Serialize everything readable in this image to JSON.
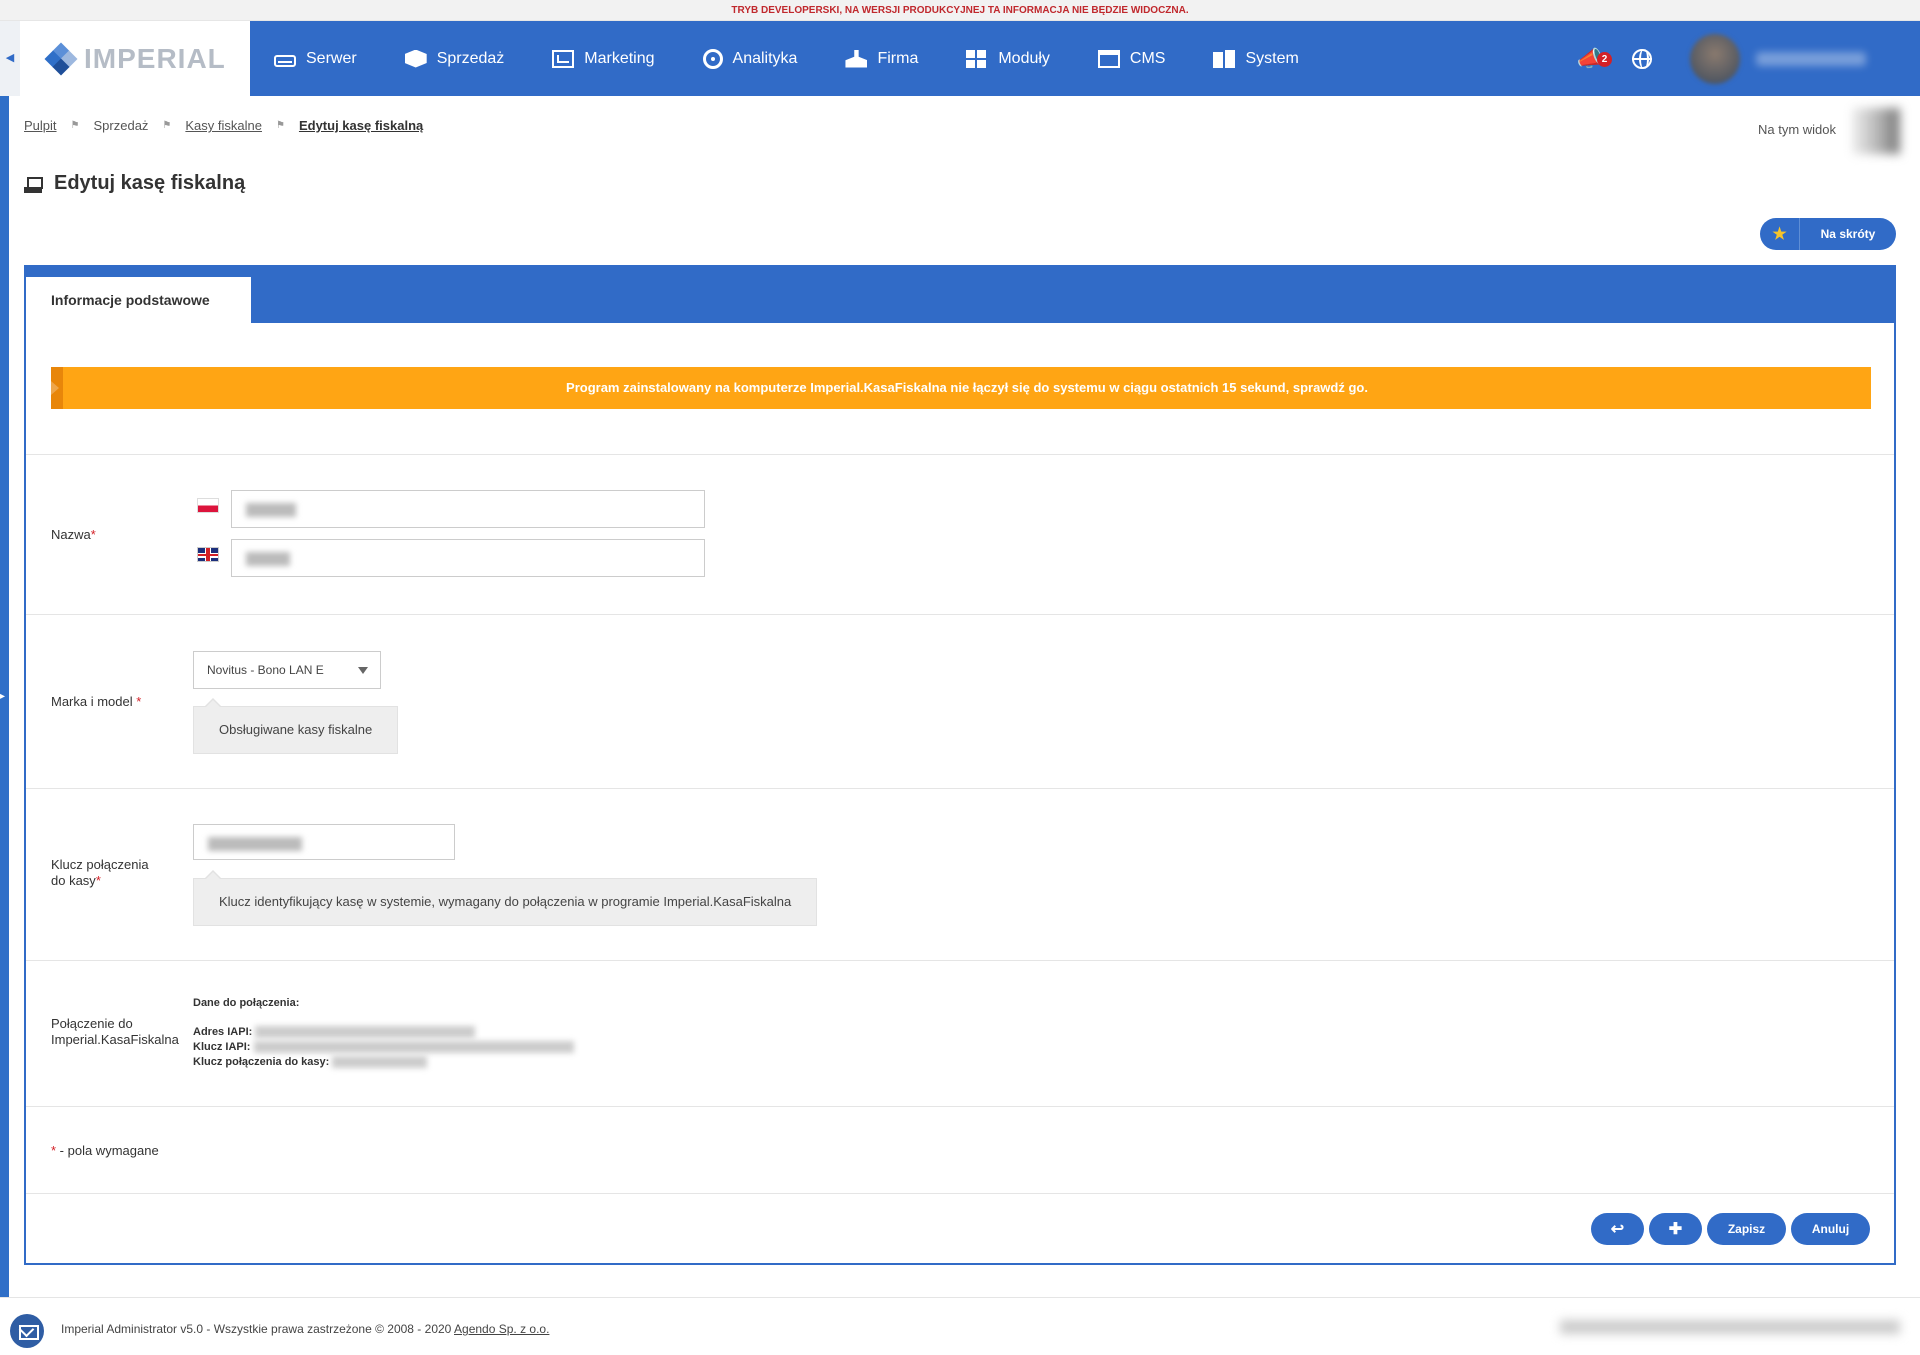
{
  "dev_banner": "TRYB DEVELOPERSKI, NA WERSJI PRODUKCYJNEJ TA INFORMACJA NIE BĘDZIE WIDOCZNA.",
  "app": {
    "logo_text": "IMPERIAL"
  },
  "nav": {
    "items": [
      {
        "label": "Serwer",
        "icon": "server-icon"
      },
      {
        "label": "Sprzedaż",
        "icon": "box-icon"
      },
      {
        "label": "Marketing",
        "icon": "presentation-icon"
      },
      {
        "label": "Analityka",
        "icon": "chart-icon"
      },
      {
        "label": "Firma",
        "icon": "building-icon"
      },
      {
        "label": "Moduły",
        "icon": "grid-icon"
      },
      {
        "label": "CMS",
        "icon": "cms-icon"
      },
      {
        "label": "System",
        "icon": "system-icon"
      }
    ],
    "notifications_count": "2"
  },
  "breadcrumb": {
    "items": [
      "Pulpit",
      "Sprzedaż",
      "Kasy fiskalne",
      "Edytuj kasę fiskalną"
    ]
  },
  "view_label": "Na tym widoku",
  "page_title": "Edytuj kasę fiskalną",
  "shortcut_button": "Na skróty",
  "tabs": {
    "active": "Informacje podstawowe"
  },
  "alert": "Program zainstalowany na komputerze Imperial.KasaFiskalna nie łączył się do systemu w ciągu ostatnich 15 sekund, sprawdź go.",
  "form": {
    "name_label": "Nazwa",
    "brand_label": "Marka i model ",
    "brand_value": "Novitus - Bono LAN E",
    "brand_hint": "Obsługiwane kasy fiskalne",
    "key_label_line1": "Klucz połączenia",
    "key_label_line2": "do kasy",
    "key_hint": "Klucz identyfikujący kasę w systemie, wymagany do połączenia w programie Imperial.KasaFiskalna",
    "conn_label_line1": "Połączenie do",
    "conn_label_line2": "Imperial.KasaFiskalna",
    "conn_title": "Dane do połączenia:",
    "conn_address_label": "Adres IAPI:",
    "conn_key_label": "Klucz IAPI:",
    "conn_register_key_label": "Klucz połączenia do kasy:",
    "required_star": "*",
    "required_note": " - pola wymagane"
  },
  "actions": {
    "save": "Zapisz",
    "cancel": "Anuluj"
  },
  "footer": {
    "text": "Imperial Administrator v5.0 - Wszystkie prawa zastrzeżone © 2008 - 2020 ",
    "link": "Agendo Sp. z o.o."
  },
  "colors": {
    "primary": "#316bc7",
    "alert": "#ffa514",
    "required": "#d32027",
    "dev_banner_text": "#c0282d"
  }
}
